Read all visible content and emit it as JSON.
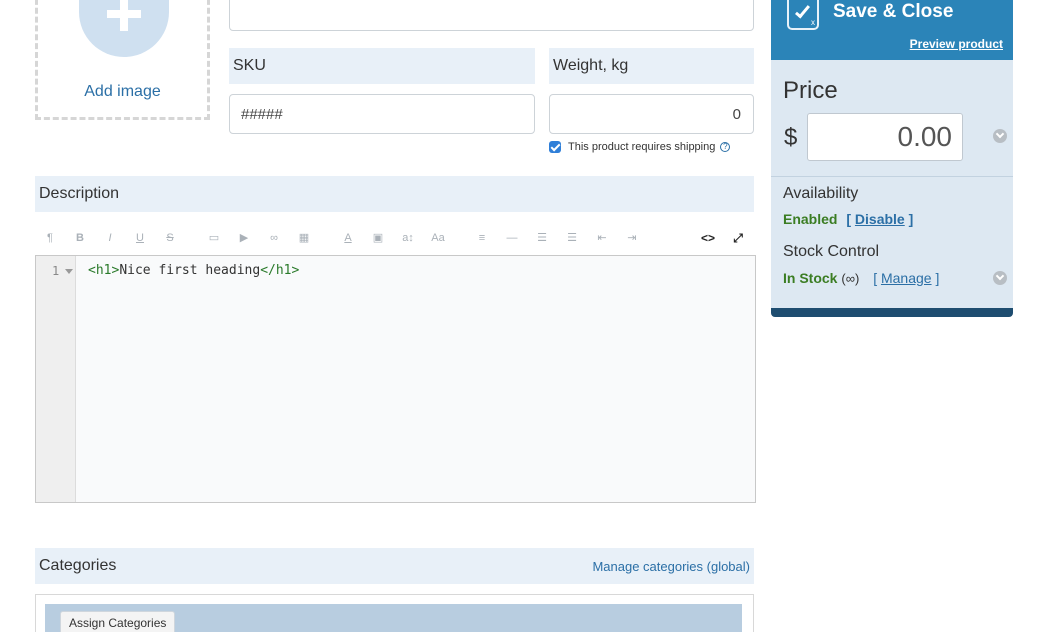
{
  "image_upload": {
    "label": "Add image"
  },
  "sku": {
    "label": "SKU",
    "value": "#####"
  },
  "weight": {
    "label": "Weight, kg",
    "value": "0"
  },
  "shipping": {
    "label": "This product requires shipping",
    "checked": true,
    "help": "?"
  },
  "description": {
    "label": "Description",
    "toolbar": [
      "paragraph-icon",
      "bold-icon",
      "italic-icon",
      "underline-icon",
      "strikethrough-icon",
      "image-icon",
      "video-icon",
      "link-icon",
      "table-icon",
      "font-color-icon",
      "background-color-icon",
      "font-size-icon",
      "font-family-icon",
      "align-icon",
      "horizontal-rule-icon",
      "unordered-list-icon",
      "ordered-list-icon",
      "outdent-icon",
      "indent-icon",
      "code-view-icon",
      "fullscreen-icon"
    ],
    "code_toggle": "<>",
    "line_number": "1",
    "code": {
      "open_tag": "<h1>",
      "text": "Nice first heading",
      "close_tag": "</h1>"
    }
  },
  "categories": {
    "label": "Categories",
    "manage_link": "Manage categories (global)",
    "assign_button": "Assign Categories"
  },
  "sidebar": {
    "save_label": "Save & Close",
    "preview_link": "Preview product",
    "price_label": "Price",
    "currency": "$",
    "price_value": "0.00",
    "availability_label": "Availability",
    "availability_status": "Enabled",
    "availability_action": "Disable",
    "stock_label": "Stock Control",
    "stock_status": "In Stock",
    "stock_qty": "(∞)",
    "stock_action": "Manage"
  },
  "colors": {
    "accent": "#2b84b8",
    "header_bg": "#e8f0f8",
    "sidebar_bg": "#dde8f2",
    "enabled_green": "#3b7d23"
  }
}
